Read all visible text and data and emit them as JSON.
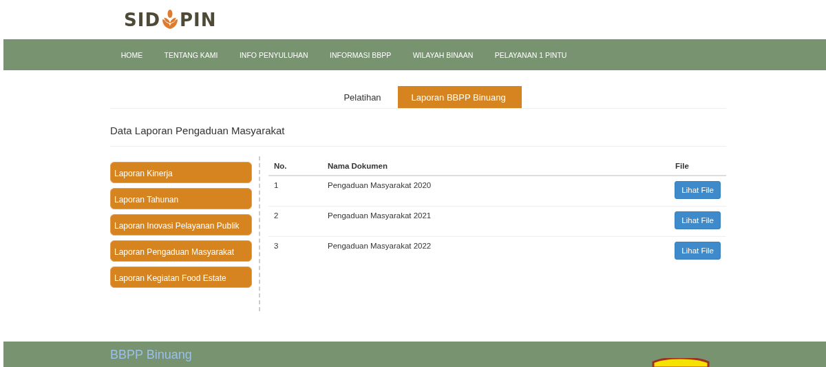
{
  "logo": {
    "left": "SID",
    "right": "PIN"
  },
  "nav": [
    "HOME",
    "TENTANG KAMI",
    "INFO PENYULUHAN",
    "INFORMASI BBPP",
    "WILAYAH BINAAN",
    "PELAYANAN 1 PINTU"
  ],
  "tabs": [
    {
      "label": "Pelatihan",
      "selected": false
    },
    {
      "label": "Laporan BBPP Binuang",
      "selected": true
    }
  ],
  "heading": "Data Laporan Pengaduan Masyarakat",
  "sidebar": {
    "items": [
      "Laporan Kinerja",
      "Laporan Tahunan",
      "Laporan Inovasi Pelayanan Publik",
      "Laporan Pengaduan Masyarakat",
      "Laporan Kegiatan Food Estate"
    ]
  },
  "table": {
    "columns": [
      "No.",
      "Nama Dokumen",
      "File"
    ],
    "rows": [
      {
        "no": "1",
        "name": "Pengaduan Masyarakat 2020",
        "action": "Lihat File"
      },
      {
        "no": "2",
        "name": "Pengaduan Masyarakat 2021",
        "action": "Lihat File"
      },
      {
        "no": "3",
        "name": "Pengaduan Masyarakat 2022",
        "action": "Lihat File"
      }
    ]
  },
  "footer": {
    "title": "BBPP Binuang"
  }
}
